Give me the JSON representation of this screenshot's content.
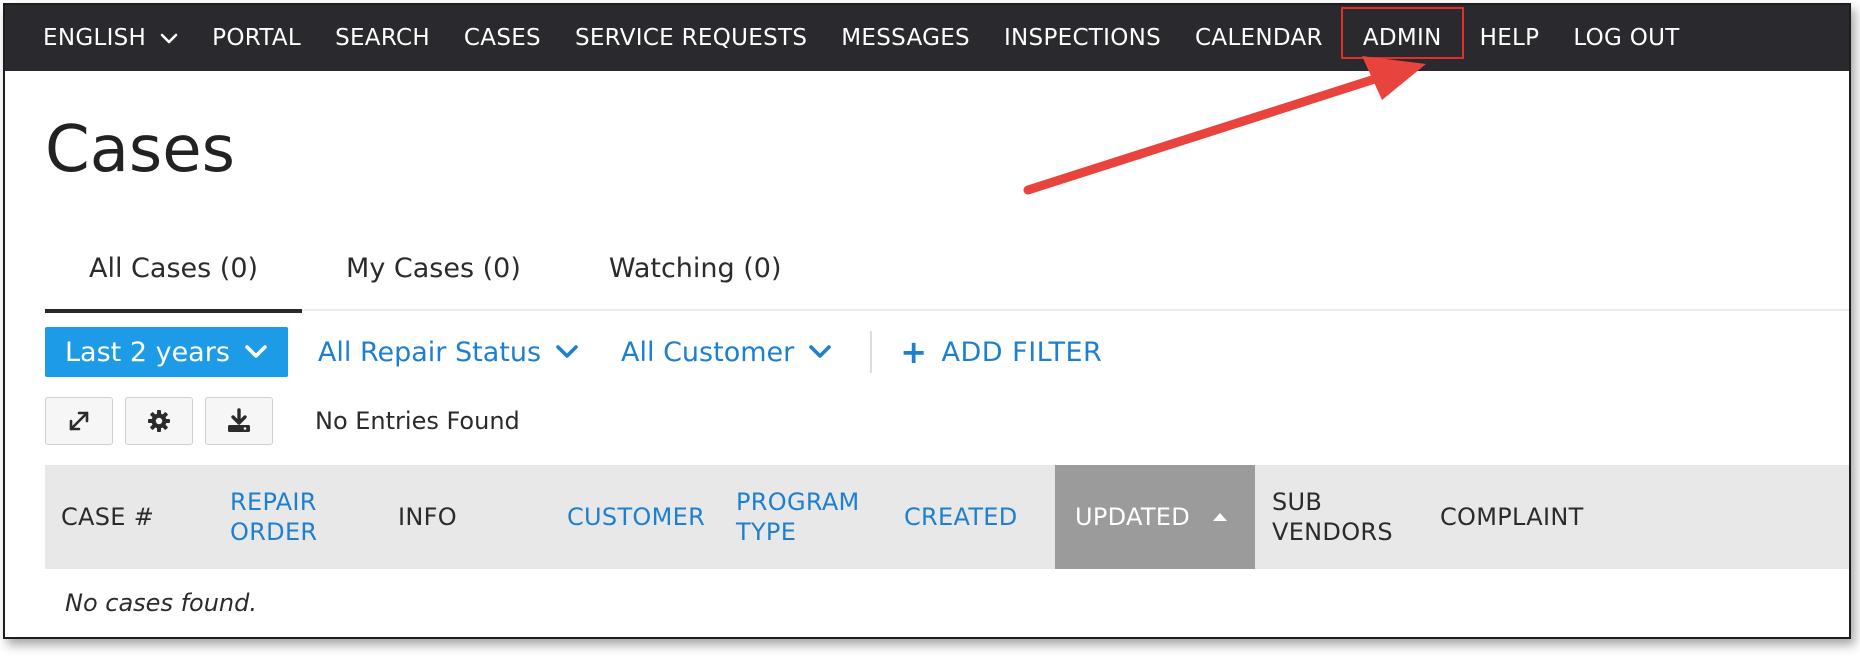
{
  "nav": {
    "language": "ENGLISH",
    "items": [
      "PORTAL",
      "SEARCH",
      "CASES",
      "SERVICE REQUESTS",
      "MESSAGES",
      "INSPECTIONS",
      "CALENDAR",
      "ADMIN",
      "HELP",
      "LOG OUT"
    ],
    "highlighted": "ADMIN"
  },
  "page": {
    "title": "Cases"
  },
  "tabs": [
    {
      "label": "All Cases (0)",
      "active": true
    },
    {
      "label": "My Cases (0)",
      "active": false
    },
    {
      "label": "Watching (0)",
      "active": false
    }
  ],
  "filters": {
    "date_range": "Last 2 years",
    "repair_status": "All Repair Status",
    "customer": "All Customer",
    "add_filter": "ADD FILTER"
  },
  "toolbar": {
    "icons": [
      "expand-icon",
      "gear-icon",
      "download-icon"
    ],
    "status": "No Entries Found"
  },
  "table": {
    "columns": [
      {
        "label": "CASE #",
        "sortable": false
      },
      {
        "label": "REPAIR ORDER",
        "sortable": true
      },
      {
        "label": "INFO",
        "sortable": false
      },
      {
        "label": "CUSTOMER",
        "sortable": true
      },
      {
        "label": "PROGRAM TYPE",
        "sortable": true
      },
      {
        "label": "CREATED",
        "sortable": true
      },
      {
        "label": "UPDATED",
        "sortable": true,
        "sorted": "asc"
      },
      {
        "label": "SUB VENDORS",
        "sortable": false
      },
      {
        "label": "COMPLAINT",
        "sortable": false
      }
    ],
    "empty_message": "No cases found."
  },
  "colors": {
    "nav_bg": "#2a2a2e",
    "accent_blue": "#1e9be6",
    "link_blue": "#1e7fd0",
    "sorted_header": "#9b9b9b",
    "annotation_red": "#e0302a"
  }
}
